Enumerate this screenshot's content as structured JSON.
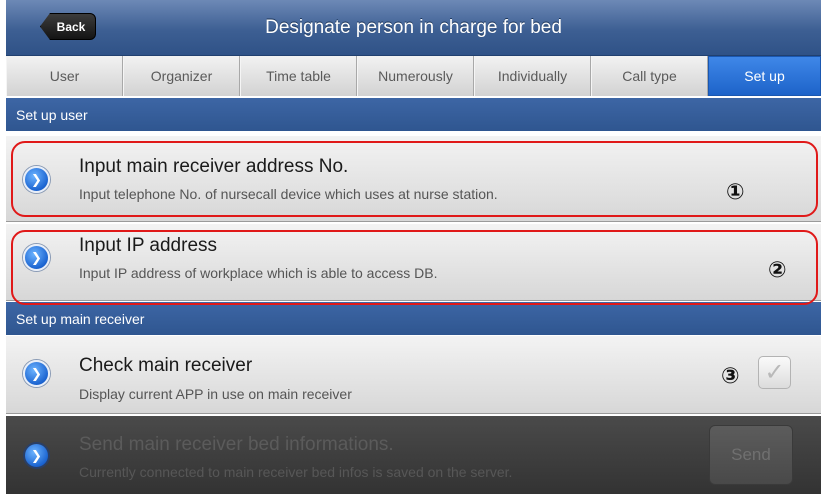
{
  "header": {
    "back_label": "Back",
    "title": "Designate person in charge for bed"
  },
  "tabs": [
    {
      "label": "User"
    },
    {
      "label": "Organizer"
    },
    {
      "label": "Time table"
    },
    {
      "label": "Numerously"
    },
    {
      "label": "Individually"
    },
    {
      "label": "Call type"
    },
    {
      "label": "Set up",
      "active": true
    }
  ],
  "sections": {
    "user": "Set up user",
    "main_receiver": "Set up main receiver"
  },
  "rows": {
    "receiver_address": {
      "title": "Input main receiver address No.",
      "subtitle": "Input telephone No. of nursecall device which uses at nurse station.",
      "marker": "①"
    },
    "ip_address": {
      "title": "Input IP address",
      "subtitle": "Input IP address of workplace which is able to access DB.",
      "marker": "②"
    },
    "check_receiver": {
      "title": "Check main receiver",
      "subtitle": "Display current APP in use on main receiver",
      "marker": "③",
      "checked": true
    },
    "send_bed_info": {
      "title": "Send main receiver bed informations.",
      "subtitle": "Currently connected to main receiver bed infos is saved on the server.",
      "button_label": "Send",
      "enabled": false
    }
  },
  "icons": {
    "arrow": "chevron-right-icon",
    "check": "checkmark-icon"
  },
  "colors": {
    "accent": "#2563c9",
    "highlight": "#e01919",
    "section_bg": "#34609a"
  }
}
